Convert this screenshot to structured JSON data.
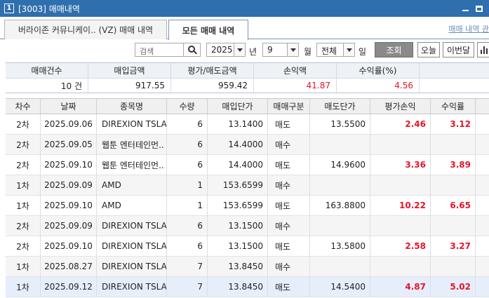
{
  "window": {
    "number": "1",
    "title": "[3003] 매매내역"
  },
  "tabs": [
    {
      "label": "버라이존 커뮤니케이.. (VZ) 매매 내역",
      "active": false
    },
    {
      "label": "모든 매매 내역",
      "active": true
    }
  ],
  "tab_link": "매매 내역 관",
  "toolbar": {
    "search_placeholder": "검색",
    "year": "2025",
    "year_label": "년",
    "month": "9",
    "month_label": "월",
    "kind": "전체",
    "day_label": "일",
    "query_label": "조회",
    "today_label": "오늘",
    "week_label": "이번달"
  },
  "summary": {
    "headers": [
      "매매건수",
      "매입금액",
      "평가/매도금액",
      "손익액",
      "수익률(%)",
      ""
    ],
    "values": [
      "10 건",
      "917.55",
      "959.42",
      "41.87",
      "4.56",
      ""
    ]
  },
  "grid": {
    "headers": [
      "차수",
      "날짜",
      "종목명",
      "수량",
      "매입단가",
      "매매구분",
      "매도단가",
      "평가손익",
      "수익률",
      ""
    ],
    "rows": [
      [
        "2차",
        "2025.09.06",
        "DIREXION TSLA",
        "6",
        "13.1400",
        "매도",
        "13.5500",
        "2.46",
        "3.12"
      ],
      [
        "2차",
        "2025.09.05",
        "웹툰 엔터테인먼..",
        "6",
        "14.4000",
        "매수",
        "",
        "",
        ""
      ],
      [
        "2차",
        "2025.09.10",
        "웹툰 엔터테인먼..",
        "6",
        "14.4000",
        "매도",
        "14.9600",
        "3.36",
        "3.89"
      ],
      [
        "1차",
        "2025.09.09",
        "AMD",
        "1",
        "153.6599",
        "매수",
        "",
        "",
        ""
      ],
      [
        "1차",
        "2025.09.10",
        "AMD",
        "1",
        "153.6599",
        "매도",
        "163.8800",
        "10.22",
        "6.65"
      ],
      [
        "2차",
        "2025.09.09",
        "DIREXION TSLA",
        "6",
        "13.1500",
        "매수",
        "",
        "",
        ""
      ],
      [
        "2차",
        "2025.09.10",
        "DIREXION TSLA",
        "6",
        "13.1500",
        "매도",
        "13.5800",
        "2.58",
        "3.27"
      ],
      [
        "1차",
        "2025.08.27",
        "DIREXION TSLA",
        "7",
        "13.8450",
        "매수",
        "",
        "",
        ""
      ],
      [
        "1차",
        "2025.09.12",
        "DIREXION TSLA",
        "7",
        "13.8450",
        "매도",
        "14.5400",
        "4.87",
        "5.02"
      ]
    ]
  }
}
